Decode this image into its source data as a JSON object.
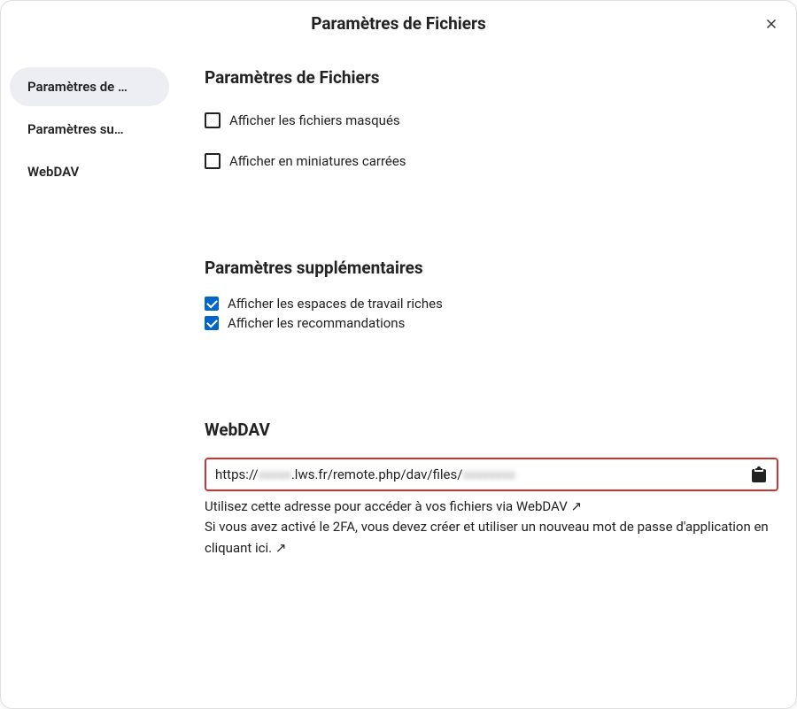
{
  "header": {
    "title": "Paramètres de Fichiers"
  },
  "sidebar": {
    "items": [
      {
        "label": "Paramètres de …",
        "active": true
      },
      {
        "label": "Paramètres su…",
        "active": false
      },
      {
        "label": "WebDAV",
        "active": false
      }
    ]
  },
  "sections": {
    "files": {
      "title": "Paramètres de Fichiers",
      "checkboxes": [
        {
          "label": "Afficher les fichiers masqués",
          "checked": false
        },
        {
          "label": "Afficher en miniatures carrées",
          "checked": false
        }
      ]
    },
    "additional": {
      "title": "Paramètres supplémentaires",
      "checkboxes": [
        {
          "label": "Afficher les espaces de travail riches",
          "checked": true
        },
        {
          "label": "Afficher les recommandations",
          "checked": true
        }
      ]
    },
    "webdav": {
      "title": "WebDAV",
      "url_prefix": "https://",
      "url_hidden1": "xxxxx",
      "url_mid": ".lws.fr/remote.php/dav/files/",
      "url_hidden2": "xxxxxxxx",
      "help1": "Utilisez cette adresse pour accéder à vos fichiers via WebDAV ↗",
      "help2": "Si vous avez activé le 2FA, vous devez créer et utiliser un nouveau mot de passe d'application en cliquant ici. ↗"
    }
  }
}
